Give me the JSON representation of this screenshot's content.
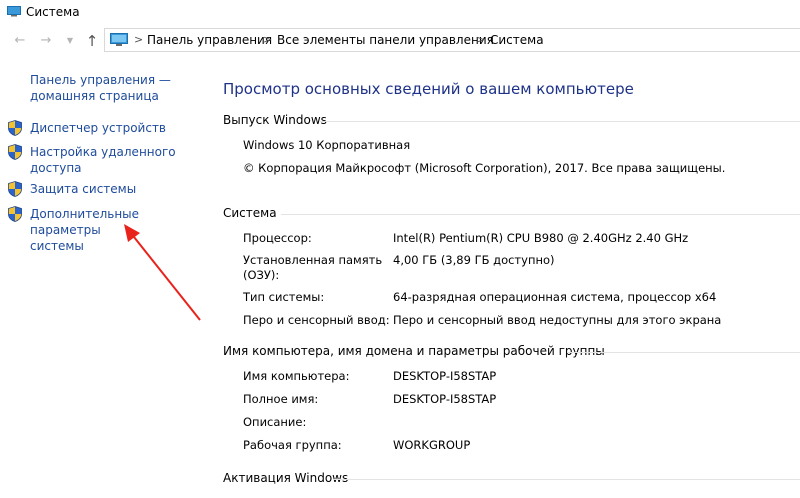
{
  "window": {
    "title": "Система"
  },
  "breadcrumb": {
    "items": [
      "Панель управления",
      "Все элементы панели управления",
      "Система"
    ]
  },
  "sidebar": {
    "home_line1": "Панель управления —",
    "home_line2": "домашняя страница",
    "links": [
      {
        "label": "Диспетчер устройств"
      },
      {
        "label_line1": "Настройка удаленного",
        "label_line2": "доступа"
      },
      {
        "label": "Защита системы"
      },
      {
        "label_line1": "Дополнительные параметры",
        "label_line2": "системы"
      }
    ]
  },
  "main": {
    "title": "Просмотр основных сведений о вашем компьютере",
    "edition": {
      "heading": "Выпуск Windows",
      "name": "Windows 10 Корпоративная",
      "copyright": "© Корпорация Майкрософт (Microsoft Corporation), 2017. Все права защищены."
    },
    "system": {
      "heading": "Система",
      "rows": [
        {
          "label": "Процессор:",
          "value": "Intel(R) Pentium(R) CPU B980 @ 2.40GHz   2.40 GHz"
        },
        {
          "label_line1": "Установленная память",
          "label_line2": "(ОЗУ):",
          "value": "4,00 ГБ (3,89 ГБ доступно)"
        },
        {
          "label": "Тип системы:",
          "value": "64-разрядная операционная система, процессор x64"
        },
        {
          "label": "Перо и сенсорный ввод:",
          "value": "Перо и сенсорный ввод недоступны для этого экрана"
        }
      ]
    },
    "computer": {
      "heading": "Имя компьютера, имя домена и параметры рабочей группы",
      "rows": [
        {
          "label": "Имя компьютера:",
          "value": "DESKTOP-I58STAP"
        },
        {
          "label": "Полное имя:",
          "value": "DESKTOP-I58STAP"
        },
        {
          "label": "Описание:",
          "value": ""
        },
        {
          "label": "Рабочая группа:",
          "value": "WORKGROUP"
        }
      ]
    },
    "activation": {
      "heading": "Активация Windows"
    }
  },
  "icons": {
    "title": "computer-icon",
    "back": "arrow-left-icon",
    "forward": "arrow-right-icon",
    "recent": "chevron-down-icon",
    "up": "arrow-up-icon",
    "address": "computer-icon",
    "sidebar": "uac-shield-icon"
  },
  "colors": {
    "link": "#1e4b9b",
    "title": "#1e3287",
    "annotation_arrow": "#e8231c"
  }
}
